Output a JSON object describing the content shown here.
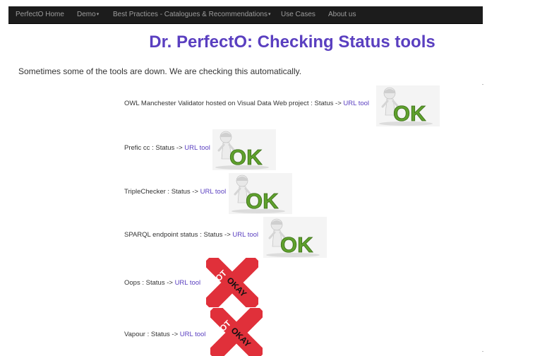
{
  "navbar": {
    "items": [
      {
        "label": "PerfectO Home",
        "dropdown": false
      },
      {
        "label": "Demo",
        "dropdown": true
      },
      {
        "label": "Best Practices - Catalogues & Recommendations",
        "dropdown": true
      },
      {
        "label": "Use Cases",
        "dropdown": false
      },
      {
        "label": "About us",
        "dropdown": false
      }
    ],
    "caret": "▾"
  },
  "page": {
    "title": "Dr. PerfectO: Checking Status tools",
    "intro": "Sometimes some of the tools are down. We are checking this automatically."
  },
  "tools": [
    {
      "name": "OWL Manchester Validator hosted on Visual Data Web project",
      "status_text": " : Status -> ",
      "link_label": "URL tool",
      "status": "ok"
    },
    {
      "name": "Prefic cc",
      "status_text": " : Status -> ",
      "link_label": "URL tool",
      "status": "ok"
    },
    {
      "name": "TripleChecker",
      "status_text": " : Status -> ",
      "link_label": "URL tool",
      "status": "ok"
    },
    {
      "name": "SPARQL endpoint status",
      "status_text": " : Status -> ",
      "link_label": "URL tool",
      "status": "ok"
    },
    {
      "name": "Oops",
      "status_text": " : Status -> ",
      "link_label": "URL tool",
      "status": "notokay"
    },
    {
      "name": "Vapour",
      "status_text": " : Status -> ",
      "link_label": "URL tool",
      "status": "notokay"
    }
  ],
  "badges": {
    "ok_text": "OK",
    "notokay_line1": "#NOT",
    "notokay_line2": "OKAY"
  },
  "colors": {
    "navbar_bg": "#1c1c1c",
    "nav_text": "#9d9d9d",
    "title": "#5a3fc0",
    "link": "#5a3fc0",
    "ok_green": "#5fa02d",
    "notokay_red": "#e0303a"
  }
}
